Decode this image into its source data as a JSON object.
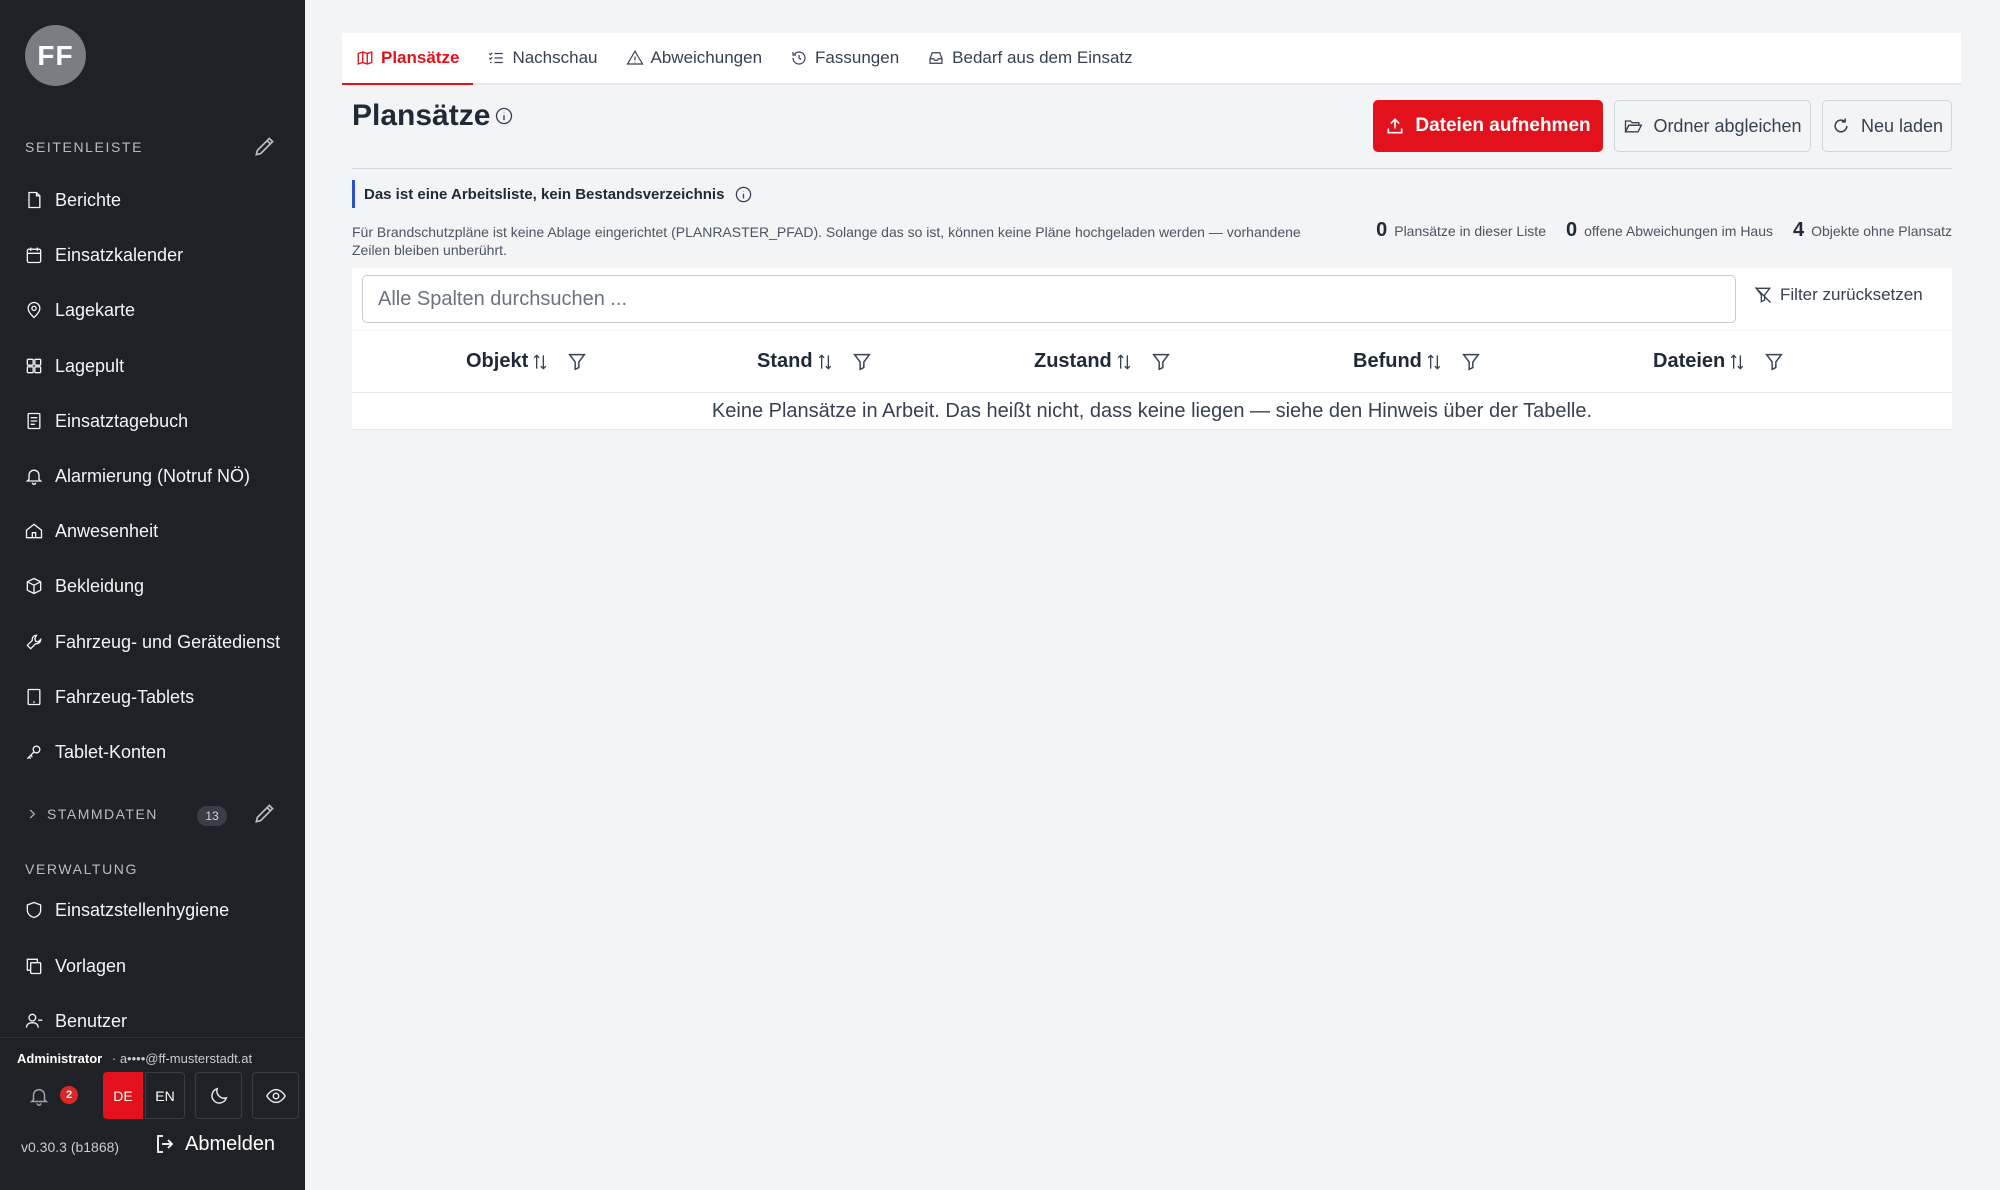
{
  "sidebar": {
    "avatar_text": "FF",
    "section_sidebar": "SEITENLEISTE",
    "items": [
      {
        "label": "Berichte",
        "icon": "file-icon"
      },
      {
        "label": "Einsatzkalender",
        "icon": "calendar-icon"
      },
      {
        "label": "Lagekarte",
        "icon": "map-pin-icon"
      },
      {
        "label": "Lagepult",
        "icon": "grid-icon"
      },
      {
        "label": "Einsatztagebuch",
        "icon": "notebook-icon"
      },
      {
        "label": "Alarmierung (Notruf NÖ)",
        "icon": "bell-icon"
      },
      {
        "label": "Anwesenheit",
        "icon": "house-icon"
      },
      {
        "label": "Bekleidung",
        "icon": "box-icon"
      },
      {
        "label": "Fahrzeug- und Gerätedienst",
        "icon": "wrench-icon"
      },
      {
        "label": "Fahrzeug-Tablets",
        "icon": "tablet-icon"
      },
      {
        "label": "Tablet-Konten",
        "icon": "key-icon"
      }
    ],
    "stammdaten_label": "STAMMDATEN",
    "stammdaten_count": "13",
    "section_verwaltung": "VERWALTUNG",
    "verwaltung_items": [
      {
        "label": "Einsatzstellenhygiene",
        "icon": "shield-icon"
      },
      {
        "label": "Vorlagen",
        "icon": "copy-icon"
      },
      {
        "label": "Benutzer",
        "icon": "user-icon"
      }
    ],
    "user_role": "Administrator",
    "user_email": "a••••@ff-musterstadt.at",
    "notifications": "2",
    "lang_de": "DE",
    "lang_en": "EN",
    "version": "v0.30.3 (b1868)",
    "logout": "Abmelden"
  },
  "tabs": [
    {
      "label": "Plansätze",
      "icon": "map-icon",
      "active": true
    },
    {
      "label": "Nachschau",
      "icon": "checklist-icon",
      "active": false
    },
    {
      "label": "Abweichungen",
      "icon": "warning-icon",
      "active": false
    },
    {
      "label": "Fassungen",
      "icon": "history-icon",
      "active": false
    },
    {
      "label": "Bedarf aus dem Einsatz",
      "icon": "inbox-icon",
      "active": false
    }
  ],
  "header": {
    "title": "Plansätze",
    "btn_upload": "Dateien aufnehmen",
    "btn_sync": "Ordner abgleichen",
    "btn_reload": "Neu laden"
  },
  "notice": {
    "title": "Das ist eine Arbeitsliste, kein Bestandsverzeichnis",
    "hint": "Für Brandschutzpläne ist keine Ablage eingerichtet (PLANRASTER_PFAD). Solange das so ist, können keine Pläne hochgeladen werden — vorhandene Zeilen bleiben unberührt."
  },
  "stats": [
    {
      "value": "0",
      "label": "Plansätze in dieser Liste"
    },
    {
      "value": "0",
      "label": "offene Abweichungen im Haus"
    },
    {
      "value": "4",
      "label": "Objekte ohne Plansatz"
    }
  ],
  "search": {
    "placeholder": "Alle Spalten durchsuchen ..."
  },
  "reset_label": "Filter zurücksetzen",
  "columns": [
    "Objekt",
    "Stand",
    "Zustand",
    "Befund",
    "Dateien"
  ],
  "empty_text": "Keine Plansätze in Arbeit. Das heißt nicht, dass keine liegen — siehe den Hinweis über der Tabelle.",
  "colors": {
    "accent": "#e3111b",
    "sidebar_bg": "#1f2127",
    "notice_bar": "#2f4fc4"
  }
}
